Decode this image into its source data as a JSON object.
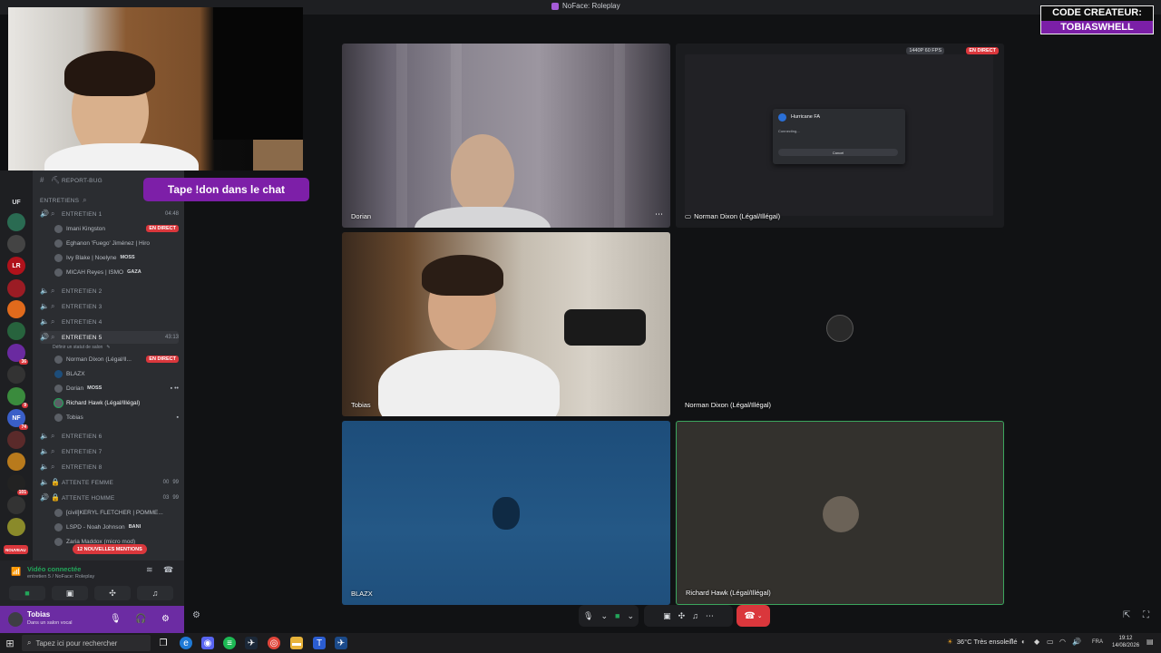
{
  "window": {
    "title": "NoFace: Roleplay"
  },
  "overlay": {
    "chat_prompt": "Tape !don dans le chat",
    "creator_code_label": "CODE CREATEUR:",
    "creator_code": "TOBIASWHELL"
  },
  "servers": [
    {
      "label": "UF"
    },
    {
      "label": ""
    },
    {
      "label": ""
    },
    {
      "label": "LR",
      "badge": ""
    },
    {
      "label": ""
    },
    {
      "label": ""
    },
    {
      "label": "",
      "badge": "36"
    },
    {
      "label": ""
    },
    {
      "label": "",
      "badge": "9"
    },
    {
      "label": "NF",
      "badge": "74"
    },
    {
      "label": ""
    },
    {
      "label": ""
    },
    {
      "label": "",
      "badge": "101"
    },
    {
      "label": ""
    },
    {
      "label": ""
    }
  ],
  "channels": {
    "report_bug": "REPORT-BUG",
    "category": "ENTRETIENS",
    "entretien1": {
      "name": "ENTRETIEN 1",
      "time": "04:48"
    },
    "e1_users": [
      {
        "name": "Imani Kingston",
        "badge": "EN DIRECT"
      },
      {
        "name": "Eghanon 'Fuego' Jiménez | Hiro"
      },
      {
        "name": "Ivy Blake | Noelyne",
        "tag": "MOSS"
      },
      {
        "name": "MICAH Reyes | ISMO",
        "tag": "GAZA"
      }
    ],
    "entretien2": "ENTRETIEN 2",
    "entretien3": "ENTRETIEN 3",
    "entretien4": "ENTRETIEN 4",
    "entretien5": {
      "name": "ENTRETIEN 5",
      "time": "43:13",
      "status": "Définir un statut de salon"
    },
    "e5_users": [
      {
        "name": "Norman Dixon (Légal/Il...",
        "badge": "EN DIRECT"
      },
      {
        "name": "BLAZX"
      },
      {
        "name": "Dorian",
        "tag": "MOSS"
      },
      {
        "name": "Richard Hawk (Légal/Illégal)"
      },
      {
        "name": "Tobias"
      }
    ],
    "entretien6": "ENTRETIEN 6",
    "entretien7": "ENTRETIEN 7",
    "entretien8": "ENTRETIEN 8",
    "attente_femme": {
      "name": "ATTENTE FEMME",
      "count": "00",
      "limit": "99"
    },
    "attente_homme": {
      "name": "ATTENTE HOMME",
      "count": "03",
      "limit": "99"
    },
    "ah_users": [
      {
        "name": "[civil]KERYL FLETCHER | POMME..."
      },
      {
        "name": "LSPD - Noah Johnson",
        "tag": "BANI"
      },
      {
        "name": "Zaria Maddox (micro mod)"
      }
    ],
    "mentions": "12 NOUVELLES MENTIONS",
    "nouveau": "NOUVEAU"
  },
  "voice": {
    "title": "Vidéo connectée",
    "subtitle": "entretien 5 / NoFace: Roleplay"
  },
  "user": {
    "name": "Tobias",
    "status": "Dans un salon vocal"
  },
  "tiles": {
    "dorian": "Dorian",
    "share": "Norman Dixon (Légal/Illégal)",
    "share_res": "1440P 60 FPS",
    "share_live": "EN DIRECT",
    "share_modal_title": "Hurricane FA",
    "share_modal_line1": "Connecting...",
    "share_modal_button": "Cancel",
    "tobias": "Tobias",
    "norman": "Norman Dixon (Légal/Illégal)",
    "blazx": "BLAZX",
    "hawk": "Richard Hawk (Légal/Illégal)"
  },
  "taskbar": {
    "search_placeholder": "Tapez ici pour rechercher",
    "weather": "36°C  Très ensoleillé",
    "lang": "FRA",
    "time": "19:12",
    "date": "14/08/2026"
  }
}
